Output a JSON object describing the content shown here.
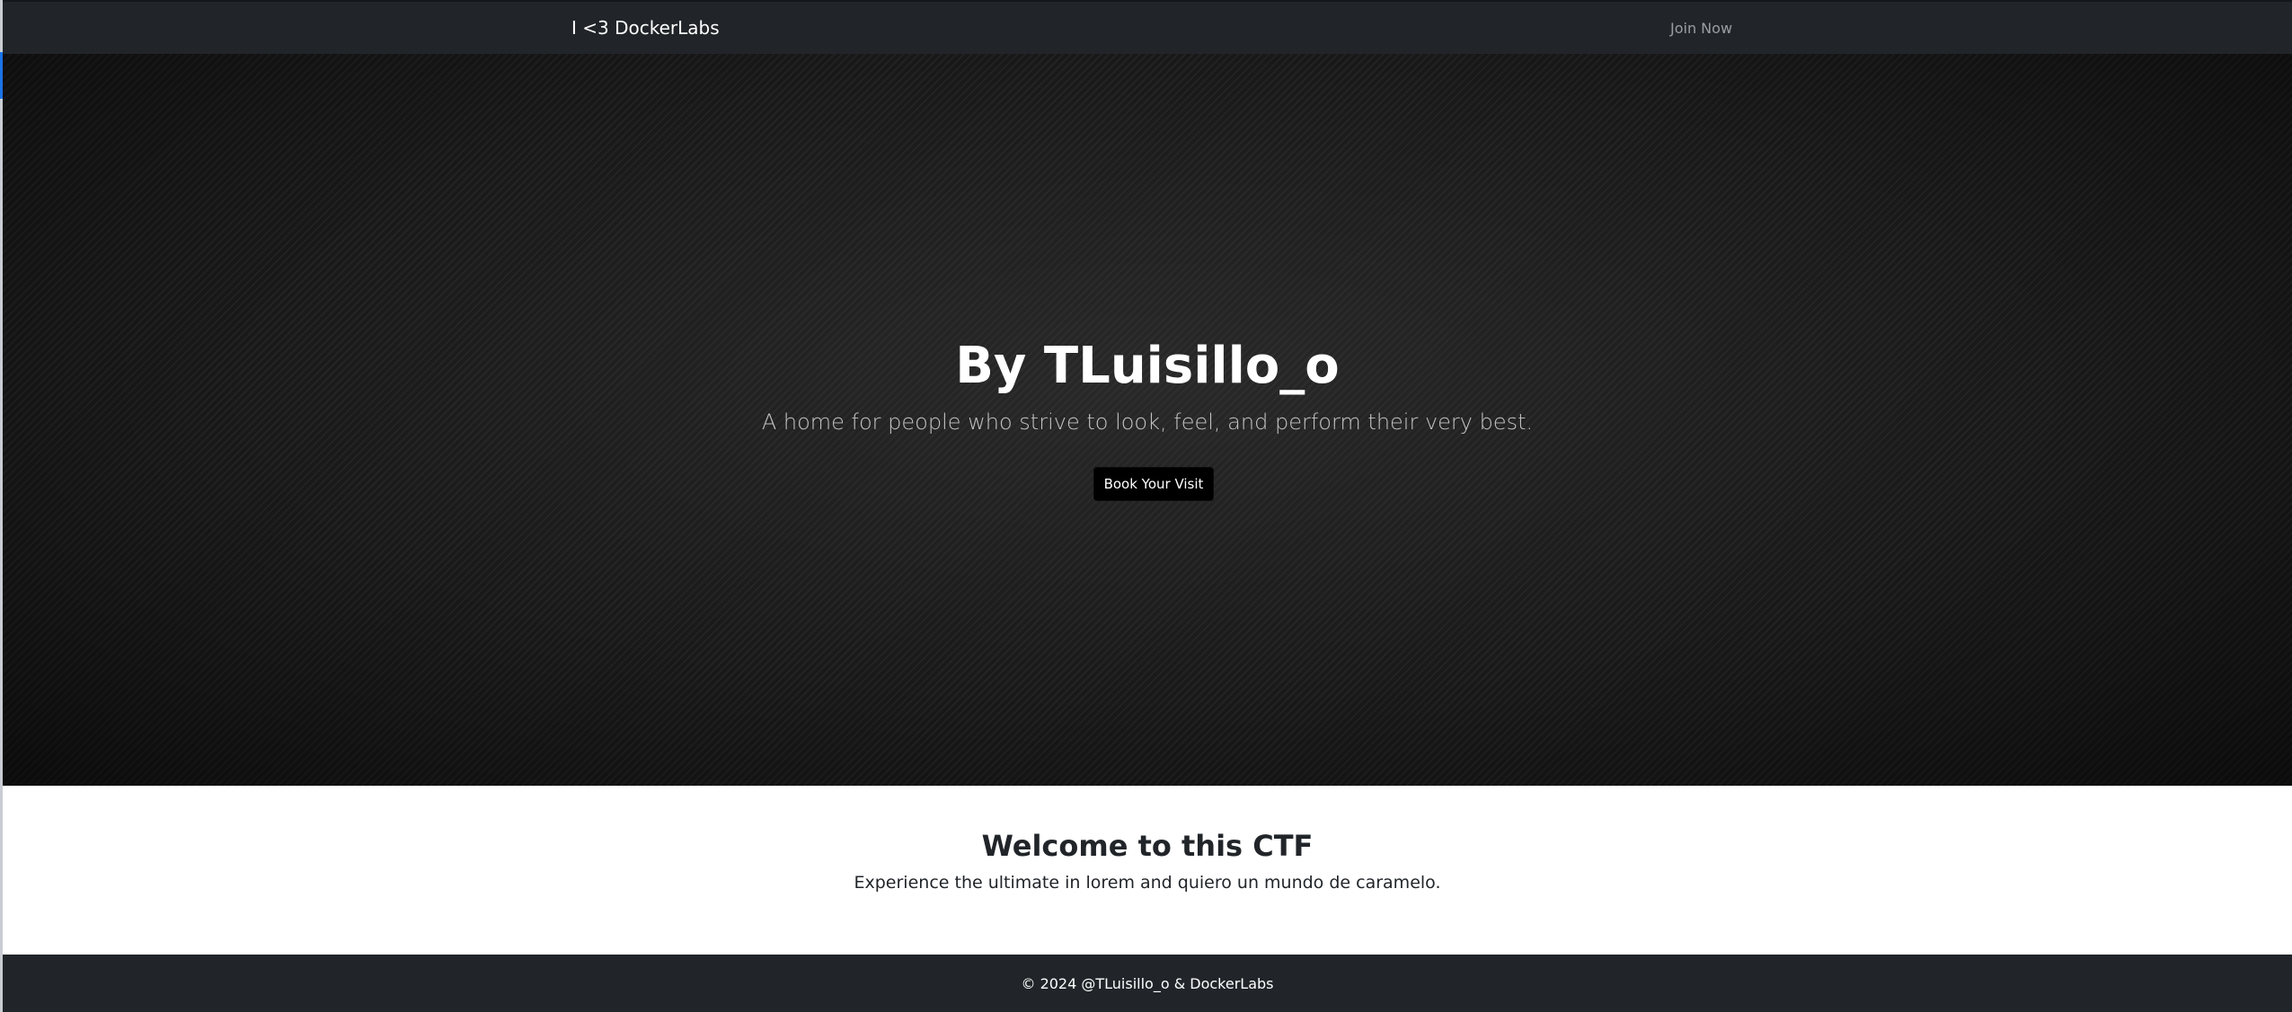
{
  "navbar": {
    "brand": "I <3 DockerLabs",
    "join_label": "Join Now"
  },
  "hero": {
    "title": "By TLuisillo_o",
    "subtitle": "A home for people who strive to look, feel, and perform their very best.",
    "cta_label": "Book Your Visit"
  },
  "welcome": {
    "title": "Welcome to this CTF",
    "text": "Experience the ultimate in lorem and quiero un mundo de caramelo."
  },
  "footer": {
    "text": "© 2024 @TLuisillo_o & DockerLabs"
  },
  "colors": {
    "navbar_bg": "#212529",
    "hero_bg": "#1b1b1b",
    "footer_bg": "#212529",
    "button_bg": "#000000"
  }
}
